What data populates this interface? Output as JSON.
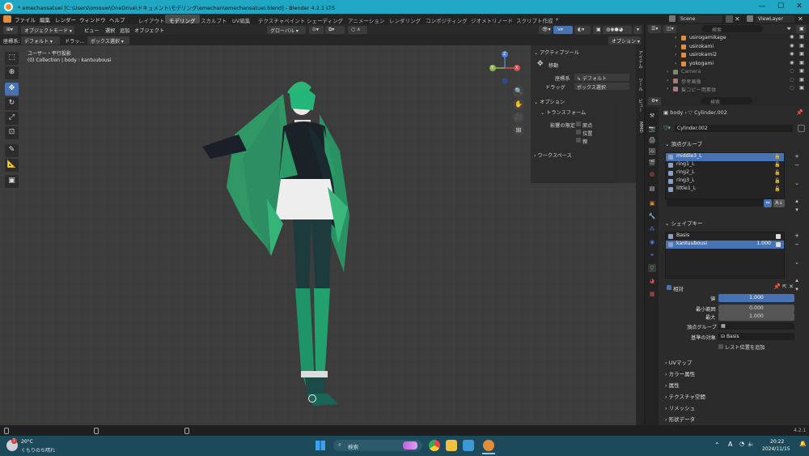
{
  "window": {
    "title": "* emechansatuei [C:\\Users\\omouw\\OneDrive\\ドキュメント\\モデリング\\emechan\\emechansatuei.blend] - Blender 4.2.1 LTS",
    "controls": [
      "—",
      "☐",
      "✕"
    ]
  },
  "menubar": {
    "menus": [
      "ファイル",
      "編集",
      "レンダー",
      "ウィンドウ",
      "ヘルプ"
    ],
    "workspaces": [
      "レイアウト",
      "モデリング",
      "スカルプト",
      "UV編集",
      "テクスチャペイント",
      "シェーディング",
      "アニメーション",
      "レンダリング",
      "コンポジティング",
      "ジオメトリノード",
      "スクリプト作成",
      "+"
    ],
    "active_workspace": "モデリング",
    "scene": "Scene",
    "view_layer": "ViewLayer"
  },
  "header": {
    "mode": "オブジェクトモード",
    "view_menus": [
      "ビュー",
      "選択",
      "追加",
      "オブジェクト"
    ],
    "orientation": "グローバル",
    "coord_label": "座標系:",
    "coord_value": "デフォルト",
    "drag_label": "ドラッ...",
    "drag_value": "ボックス選択",
    "options": "オプション"
  },
  "viewport": {
    "view_name": "ユーザー・平行投影",
    "collection_info": "(0) Collection | body : kantuubousi",
    "gizmo": {
      "x": "X",
      "y": "Y",
      "z": "Z"
    }
  },
  "npanel": {
    "active_tool": "アクティブツール",
    "move": "移動",
    "coord_label": "座標系",
    "coord_value": "デフォルト",
    "drag_label": "ドラッグ",
    "drag_value": "ボックス選択",
    "options": "オプション",
    "transform": "トランスフォーム",
    "affect_only": "影響の限定",
    "origins": "原点",
    "locations": "位置",
    "parents": "親",
    "workspace": "ワークスペース"
  },
  "vtabs": [
    "アイテム",
    "ツール",
    "ビュー",
    "MMD"
  ],
  "outliner": {
    "search_placeholder": "検索",
    "rows": [
      {
        "name": "usirogamikage",
        "color": "#e08c3a"
      },
      {
        "name": "usirokami",
        "color": "#e08c3a"
      },
      {
        "name": "usirokami2",
        "color": "#e08c3a"
      },
      {
        "name": "yokogami",
        "color": "#e08c3a"
      },
      {
        "name": "Camera",
        "color": "#7a8a6a"
      },
      {
        "name": "参考画像",
        "color": "#aa7a7a"
      },
      {
        "name": "髪コピー用素体",
        "color": "#aa7a7a"
      }
    ]
  },
  "properties": {
    "search_placeholder": "検索",
    "breadcrumb_object": "body",
    "breadcrumb_mesh": "Cylinder.002",
    "mesh_name": "Cylinder.002",
    "vertex_groups_title": "頂点グループ",
    "vertex_groups": [
      "middle3_L",
      "ring1_L",
      "ring2_L",
      "ring3_L",
      "little1_L"
    ],
    "selected_vertex_group": "middle3_L",
    "shape_keys_title": "シェイプキー",
    "shape_keys": [
      {
        "name": "Basis",
        "value": ""
      },
      {
        "name": "kantuubousi",
        "value": "1.000"
      }
    ],
    "selected_shape_key": "kantuubousi",
    "relative": "相対",
    "value_label": "値",
    "value": "1.000",
    "range_min_label": "最小範囲",
    "range_min": "0.000",
    "max_label": "最大",
    "max": "1.000",
    "vgroup_label": "頂点グループ",
    "relative_to_label": "基準の対象",
    "relative_to": "Basis",
    "rest_position": "レスト位置を追加",
    "collapsed_sections": [
      "UVマップ",
      "カラー属性",
      "属性",
      "テクスチャ空間",
      "リメッシュ",
      "形状データ"
    ]
  },
  "statusbar": {
    "version": "4.2.1"
  },
  "taskbar": {
    "weather_temp": "20°C",
    "weather_desc": "くもりのち晴れ",
    "search_placeholder": "検索",
    "time": "20:22",
    "date": "2024/11/15",
    "ime": "A"
  }
}
